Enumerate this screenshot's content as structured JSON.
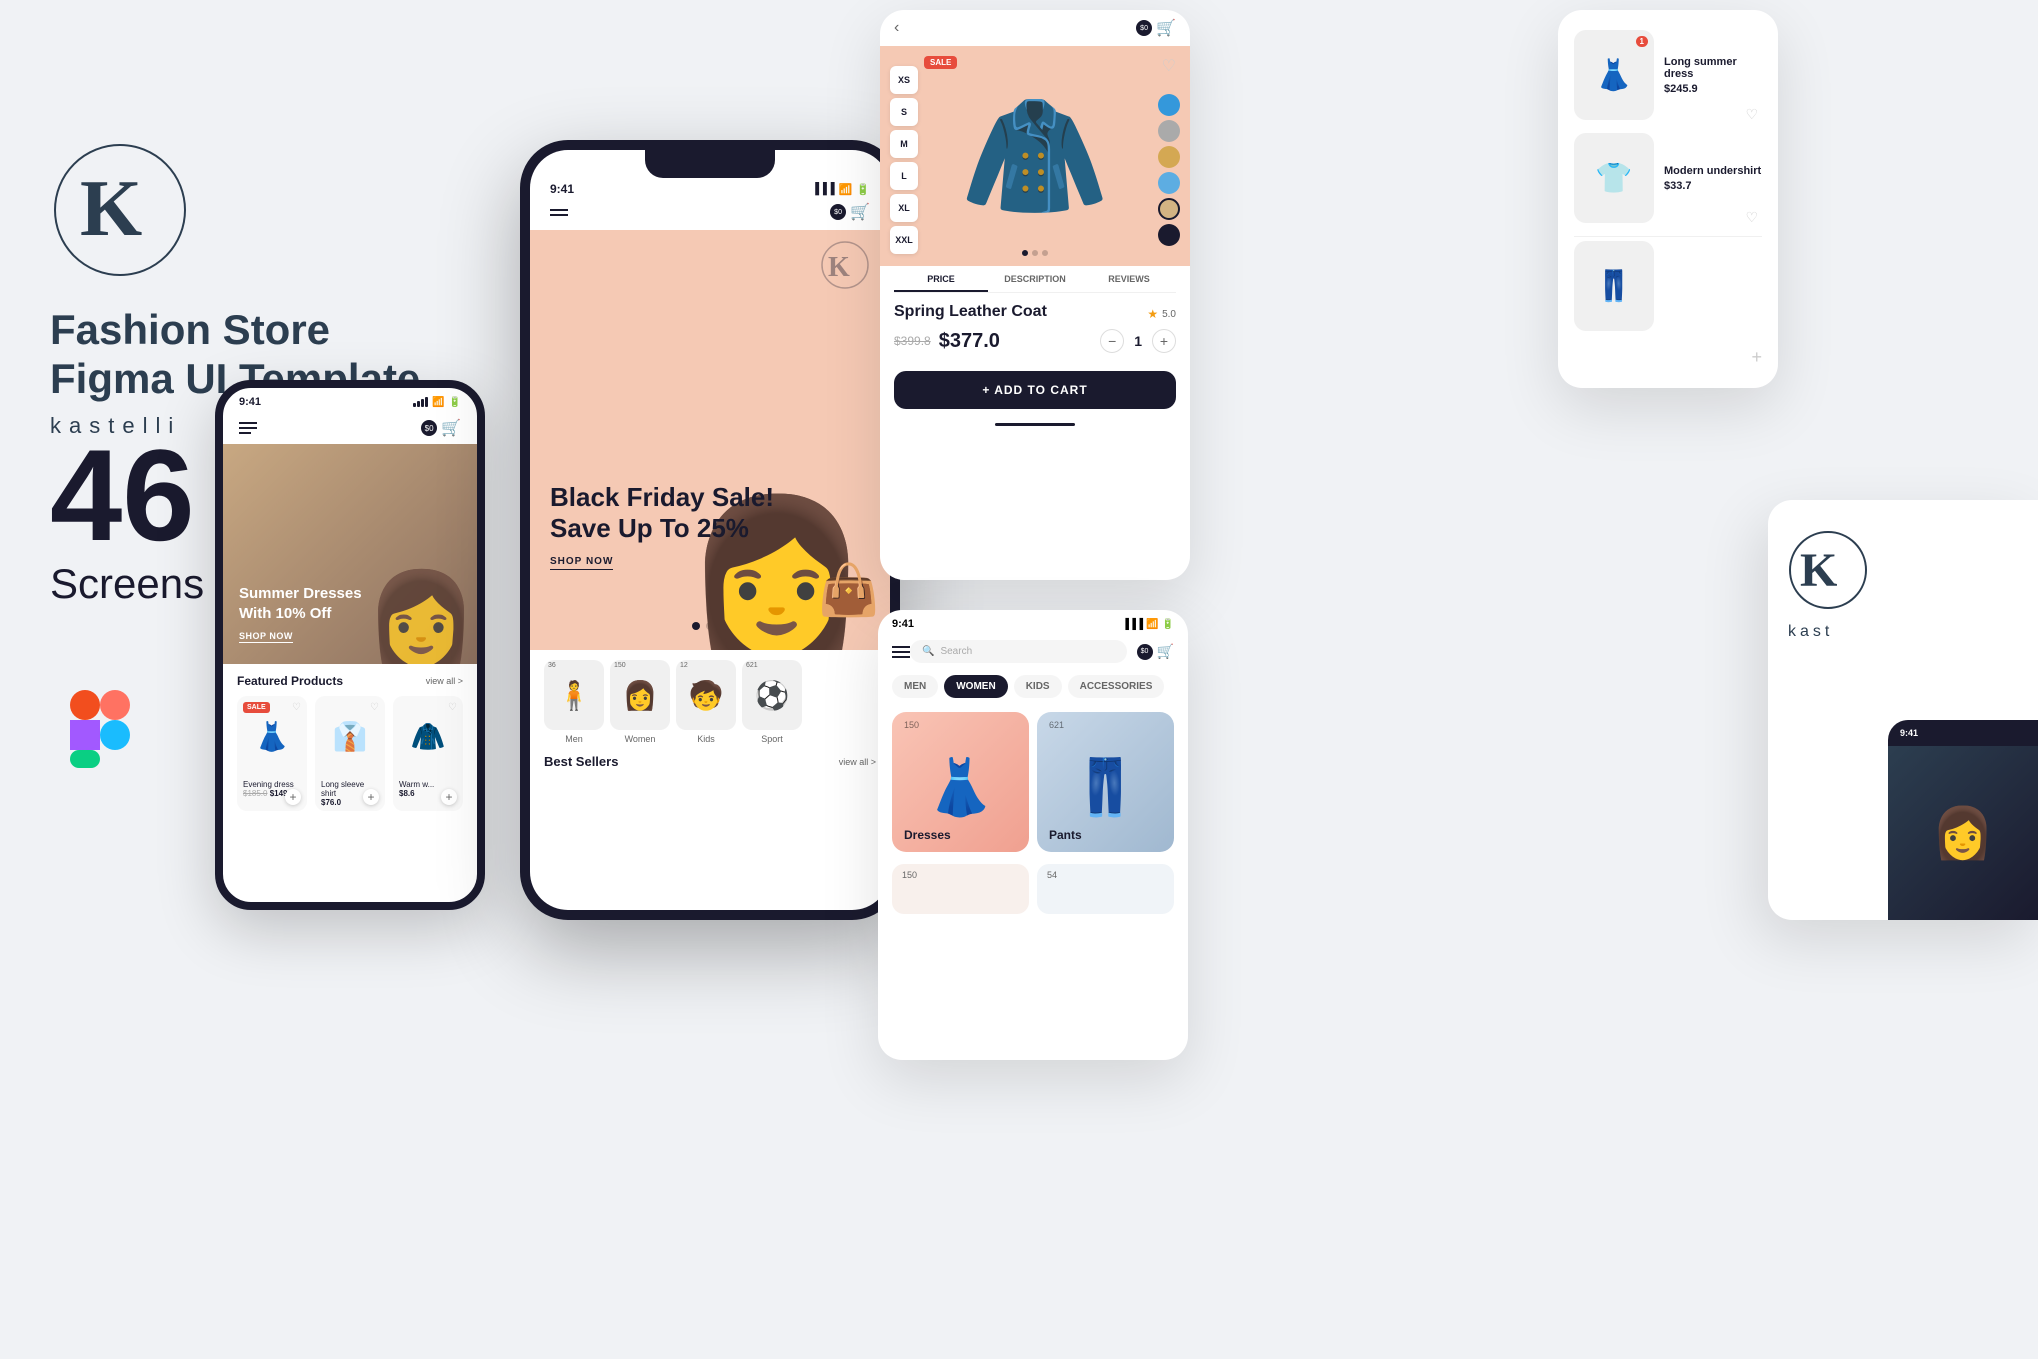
{
  "brand": {
    "logo_letter": "K",
    "title_line1": "Fashion Store",
    "title_line2": "Figma UI Template",
    "name": "kastelli"
  },
  "count": {
    "number": "46",
    "label": "Screens"
  },
  "small_phone": {
    "status_time": "9:41",
    "hero_text": "Summer Dresses\nWith 10% Off",
    "shop_now": "SHOP NOW",
    "featured_title": "Featured Products",
    "view_all": "view all >",
    "products": [
      {
        "name": "Evening dress",
        "price_original": "$185.0",
        "price_current": "$149.9",
        "emoji": "👗",
        "sale": true
      },
      {
        "name": "Long sleeve shirt",
        "price_current": "$76.0",
        "emoji": "👔",
        "sale": false
      },
      {
        "name": "Warm w...",
        "price_current": "$8.6",
        "emoji": "🧥",
        "sale": false
      }
    ]
  },
  "large_phone": {
    "status_time": "9:41",
    "hero_text_line1": "Black Friday Sale!",
    "hero_text_line2": "Save Up To 25%",
    "shop_now": "SHOP NOW",
    "categories": [
      {
        "label": "Men",
        "count": "36",
        "emoji": "🧍"
      },
      {
        "label": "Women",
        "count": "150",
        "emoji": "👩"
      },
      {
        "label": "Kids",
        "count": "12",
        "emoji": "🧒"
      },
      {
        "label": "Sport",
        "count": "621",
        "emoji": "⚽"
      }
    ],
    "best_sellers": "Best Sellers",
    "view_all": "view all >"
  },
  "product_detail": {
    "sale_badge": "SALE",
    "sizes": [
      "XS",
      "S",
      "M",
      "L",
      "XL",
      "XXL"
    ],
    "colors": [
      {
        "hex": "#3498db",
        "selected": false
      },
      {
        "hex": "#aaa",
        "selected": false
      },
      {
        "hex": "#d4a853",
        "selected": false
      },
      {
        "hex": "#5dade2",
        "selected": false
      },
      {
        "hex": "#52be80",
        "selected": false
      },
      {
        "hex": "#d4b483",
        "selected": true
      },
      {
        "hex": "#1a1a2e",
        "selected": false
      }
    ],
    "tabs": [
      "PRICE",
      "DESCRIPTION",
      "REVIEWS"
    ],
    "active_tab": "PRICE",
    "product_name": "Spring Leather Coat",
    "rating": "5.0",
    "price_original": "$399.8",
    "price_current": "$377.0",
    "quantity": "1",
    "add_to_cart": "+ ADD TO CART"
  },
  "category_phone": {
    "status_time": "9:41",
    "search_placeholder": "Search",
    "filter_tabs": [
      "MEN",
      "WOMEN",
      "KIDS",
      "ACCESSORIES"
    ],
    "active_tab": "WOMEN",
    "categories": [
      {
        "label": "Dresses",
        "count": "150",
        "color": "pink"
      },
      {
        "label": "Pants",
        "count": "621",
        "color": "blue"
      }
    ],
    "more_counts": [
      "150",
      "54"
    ]
  },
  "right_products": [
    {
      "name": "Long summer dress",
      "price": "$245.9",
      "emoji": "👗",
      "badge": "1"
    },
    {
      "name": "Modern undershirt",
      "price": "$33.7",
      "emoji": "👕"
    },
    {
      "name": "",
      "price": "",
      "emoji": "👖"
    }
  ],
  "kastelli_brand": {
    "name": "kast",
    "status_time": "9:41"
  }
}
